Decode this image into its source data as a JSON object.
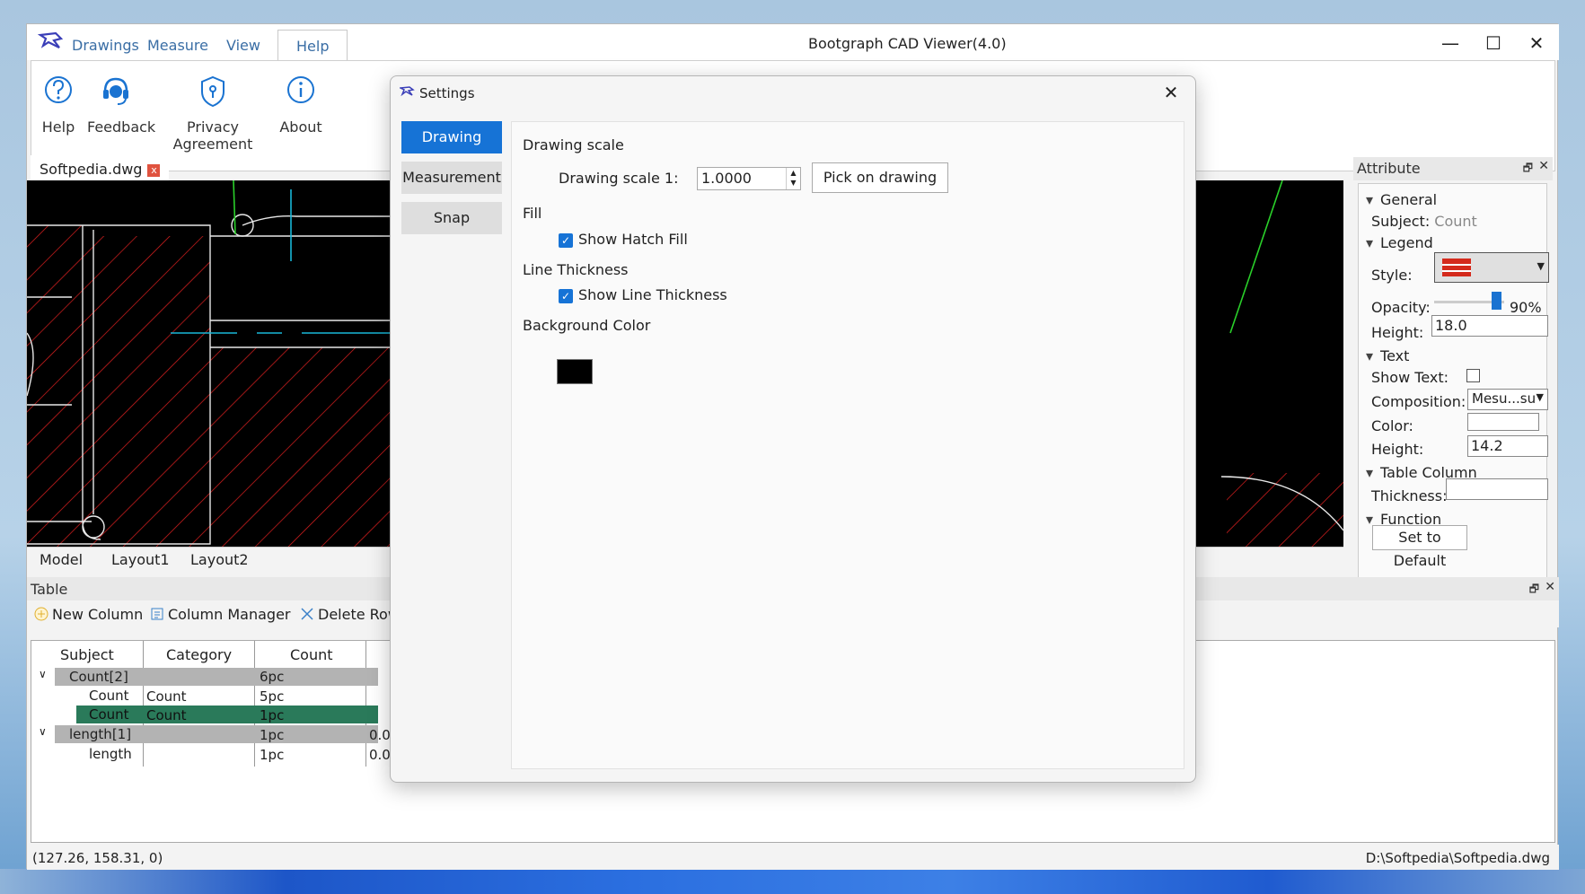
{
  "app": {
    "title": "Bootgraph CAD Viewer(4.0)",
    "menu": [
      "Drawings",
      "Measure",
      "View",
      "Help"
    ],
    "window_controls": {
      "minimize": "—",
      "maximize": "☐",
      "close": "✕"
    }
  },
  "ribbon": {
    "buttons": [
      {
        "label": "Help",
        "icon": "question-icon"
      },
      {
        "label": "Feedback",
        "icon": "headset-icon"
      },
      {
        "label": "Privacy Agreement",
        "icon": "shield-icon"
      },
      {
        "label": "About",
        "icon": "info-icon"
      }
    ]
  },
  "document": {
    "tab": "Softpedia.dwg",
    "tab_close": "x",
    "layout_tabs": [
      "Model",
      "Layout1",
      "Layout2"
    ]
  },
  "attribute": {
    "title": "Attribute",
    "pin": "🗗",
    "close": "✕",
    "general": "General",
    "subject_label": "Subject:",
    "subject_value": "Count",
    "legend": "Legend",
    "style_label": "Style:",
    "opacity_label": "Opacity:",
    "opacity_value": "90%",
    "opacity_fraction": 0.9,
    "height_label": "Height:",
    "legend_height": "18.0",
    "text": "Text",
    "show_text_label": "Show Text:",
    "composition_label": "Composition:",
    "composition_value": "Mesu...su",
    "color_label": "Color:",
    "text_height_label": "Height:",
    "text_height": "14.2",
    "table_column": "Table Column",
    "thickness_label": "Thickness:",
    "function": "Function",
    "default_button": "Set to Default"
  },
  "table": {
    "title": "Table",
    "pin": "🗗",
    "close": "✕",
    "tools": [
      "New Column",
      "Column Manager",
      "Delete Row"
    ],
    "headers": [
      "Subject",
      "Category",
      "Count"
    ],
    "rows": [
      {
        "subject": "Count[2]",
        "category": "",
        "count": "6pc",
        "extra": ""
      },
      {
        "subject": "Count",
        "category": "Count",
        "count": "5pc",
        "extra": ""
      },
      {
        "subject": "Count",
        "category": "Count",
        "count": "1pc",
        "extra": ""
      },
      {
        "subject": "length[1]",
        "category": "",
        "count": "1pc",
        "extra": "0.0"
      },
      {
        "subject": "length",
        "category": "",
        "count": "1pc",
        "extra": "0.0"
      }
    ]
  },
  "status": {
    "coords": "(127.26, 158.31, 0)",
    "path": "D:\\Softpedia\\Softpedia.dwg"
  },
  "dialog": {
    "title": "Settings",
    "close": "✕",
    "tabs": [
      "Drawing",
      "Measurement",
      "Snap"
    ],
    "drawing_scale_header": "Drawing scale",
    "drawing_scale_label": "Drawing scale 1:",
    "drawing_scale_value": "1.0000",
    "pick_button": "Pick on drawing",
    "fill_header": "Fill",
    "show_hatch_fill": "Show Hatch Fill",
    "line_thickness_header": "Line Thickness",
    "show_line_thickness": "Show Line Thickness",
    "background_header": "Background Color",
    "checkmark": "✓"
  },
  "colors": {
    "accent": "#1673d6",
    "selected_row": "#2a7a5a",
    "group_row": "#b3b3b3",
    "hatch": "#e02020",
    "background": "#000000"
  }
}
